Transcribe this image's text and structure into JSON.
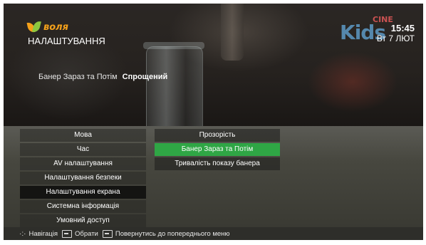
{
  "header": {
    "brand": "воля",
    "title": "НАЛАШТУВАННЯ",
    "channel_logo": {
      "main": "Kids",
      "sub": "CINE"
    },
    "time": "15:45",
    "date": "Вт 7 ЛЮТ"
  },
  "preview": {
    "label": "Банер Зараз та Потім",
    "value": "Спрощений"
  },
  "menu": {
    "items": [
      {
        "label": "Мова"
      },
      {
        "label": "Час"
      },
      {
        "label": "AV налаштування"
      },
      {
        "label": "Налаштування безпеки"
      },
      {
        "label": "Налаштування екрана",
        "active": true
      },
      {
        "label": "Системна інформація"
      },
      {
        "label": "Умовний доступ"
      }
    ]
  },
  "submenu": {
    "items": [
      {
        "label": "Прозорість"
      },
      {
        "label": "Банер Зараз та Потім",
        "active": true
      },
      {
        "label": "Тривалість показу банера"
      }
    ]
  },
  "footer": {
    "navigate": "Навігація",
    "select": "Обрати",
    "back": "Повернутись до попереднього меню"
  },
  "colors": {
    "active_green": "#2fa645",
    "brand_orange": "#f4a11a",
    "brand_green": "#8cc63f"
  }
}
